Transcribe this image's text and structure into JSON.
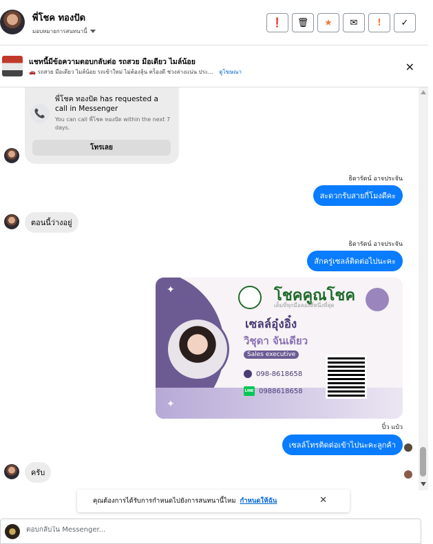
{
  "header": {
    "contact_name": "พี่โชค ทองปัด",
    "assign_label": "มอบหมายการสนทนานี้",
    "actions": [
      {
        "name": "spam-button",
        "glyph": "❗"
      },
      {
        "name": "delete-button",
        "glyph": "🗑"
      },
      {
        "name": "star-button",
        "glyph": "★"
      },
      {
        "name": "mark-unread-button",
        "glyph": "✉"
      },
      {
        "name": "follow-up-button",
        "glyph": "!"
      },
      {
        "name": "done-button",
        "glyph": "✓"
      }
    ],
    "accent": "#f5793b"
  },
  "ad": {
    "title": "แชทนี้มีข้อความตอบกลับต่อ รถสวย มือเดียว ไมล์น้อย",
    "subtitle": "🚗 รถสวย มือเดียว ไมล์น้อย รถเข้าใหม่ ไม่ต้องลุ้น คร็องดี ช่วงล่างแน่น ประ...",
    "view_ad": "ดูโฆษณา"
  },
  "call_card": {
    "title": "พี่โชค ทองปัด has requested a call in Messenger",
    "subtitle": "You can call พี่โชค ทองปัด within the next 7 days.",
    "button": "โทรเลย"
  },
  "messages": [
    {
      "sender": "ธิดารัตน์ อาจประจัน",
      "text": "สะดวกรับสายกี่โมงดีคะ"
    },
    {
      "text": "ตอนนี้ว่างอยู่"
    },
    {
      "sender": "ธิดารัตน์ อาจประจัน",
      "text": "สักครู่เซลล์ติดต่อไปนะคะ"
    },
    {
      "sender": "ปิ๋ว แป๋ว",
      "text": "เซลล์โทรติดต่อเข้าไปนะคะลูกค้า"
    },
    {
      "text": "ครับ"
    }
  ],
  "business_card": {
    "brand": "โชคคูณโชค",
    "tagline": "เต็มที่ทุกมือลองที่หนึ่งที่สุด",
    "nickname": "เซลล์อุ๋งอิ๋ง",
    "full_name": "วิชุดา จันเดียว",
    "role": "Sales executive",
    "phone": "098-8618658",
    "line": "0988618658",
    "line_badge": "LINE"
  },
  "toast": {
    "text": "คุณต้องการได้รับการกำหนดไปยังการสนทนานี้ไหม",
    "link": "กำหนดให้ฉัน"
  },
  "composer": {
    "placeholder": "ตอบกลับใน Messenger..."
  }
}
